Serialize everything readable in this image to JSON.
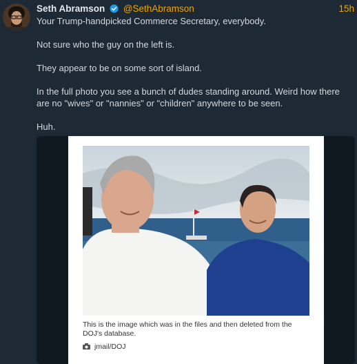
{
  "post": {
    "author_name": "Seth Abramson",
    "handle": "@SethAbramson",
    "timestamp": "15h",
    "paragraphs": [
      "Your Trump-handpicked Commerce Secretary, everybody.",
      "Not sure who the guy on the left is.",
      "They appear to be on some sort of island.",
      "In the full photo you see a bunch of dudes standing around. Weird how there are no \"wives\" or \"nannies\" or \"children\" anywhere to be seen.",
      "Huh."
    ]
  },
  "embed": {
    "caption": "This is the image which was in the files and then deleted from the DOJ's database.",
    "credit": "jmail/DOJ"
  },
  "colors": {
    "background": "#1d2a36",
    "accent": "#f0a500",
    "verified": "#1d9bf0"
  },
  "icons": {
    "verified": "verified-badge-icon",
    "camera": "camera-icon"
  }
}
